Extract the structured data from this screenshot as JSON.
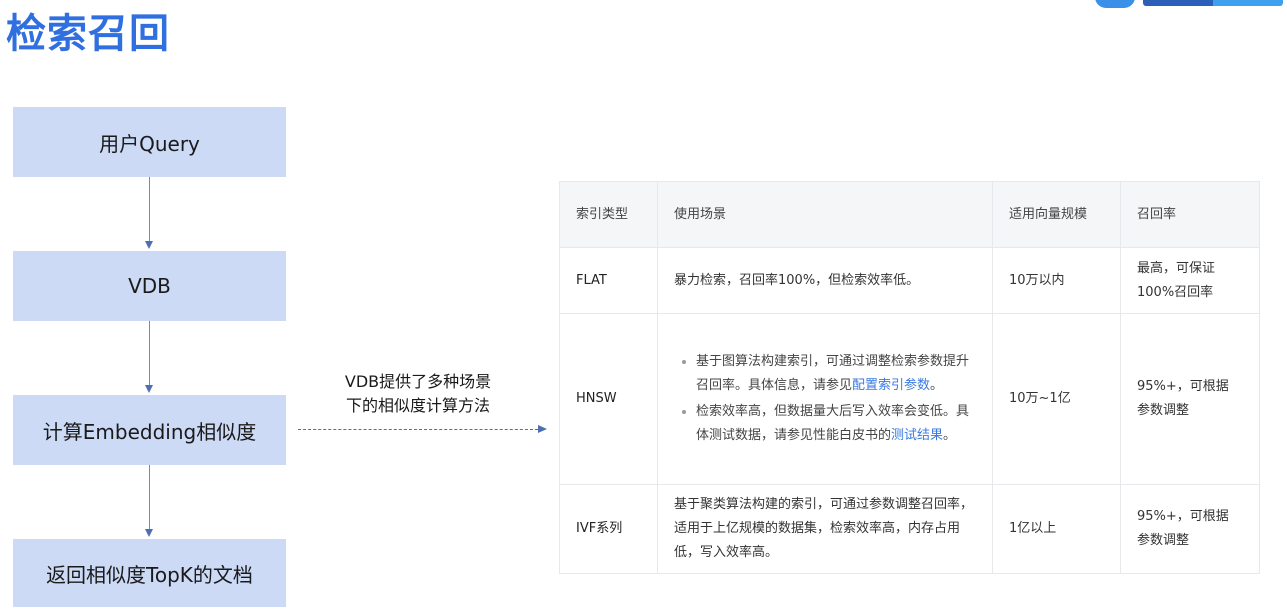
{
  "page": {
    "title": "检索召回"
  },
  "flow": {
    "steps": [
      "用户Query",
      "VDB",
      "计算Embedding相似度",
      "返回相似度TopK的文档"
    ],
    "edge_label_line1": "VDB提供了多种场景",
    "edge_label_line2": "下的相似度计算方法"
  },
  "table": {
    "headers": [
      "索引类型",
      "使用场景",
      "适用向量规模",
      "召回率"
    ],
    "flat": {
      "type": "FLAT",
      "scenario": "暴力检索，召回率100%，但检索效率低。",
      "scale": "10万以内",
      "recall_line1": "最高，可保证",
      "recall_line2": "100%召回率"
    },
    "hnsw": {
      "type": "HNSW",
      "bullet1_text": "基于图算法构建索引，可通过调整检索参数提升召回率。具体信息，请参见",
      "bullet1_link": "配置索引参数",
      "bullet1_end": "。",
      "bullet2_text": "检索效率高，但数据量大后写入效率会变低。具体测试数据，请参见性能白皮书的",
      "bullet2_link": "测试结果",
      "bullet2_end": "。",
      "scale": "10万~1亿",
      "recall_line1": "95%+，可根据",
      "recall_line2": "参数调整"
    },
    "ivf": {
      "type": "IVF系列",
      "scenario": "基于聚类算法构建的索引，可通过参数调整召回率，适用于上亿规模的数据集，检索效率高，内存占用低，写入效率高。",
      "scale": "1亿以上",
      "recall_line1": "95%+，可根据",
      "recall_line2": "参数调整"
    }
  },
  "colors": {
    "title": "#2f6fe0",
    "flow_box": "#ccdaf5",
    "link": "#3a7ae0"
  }
}
